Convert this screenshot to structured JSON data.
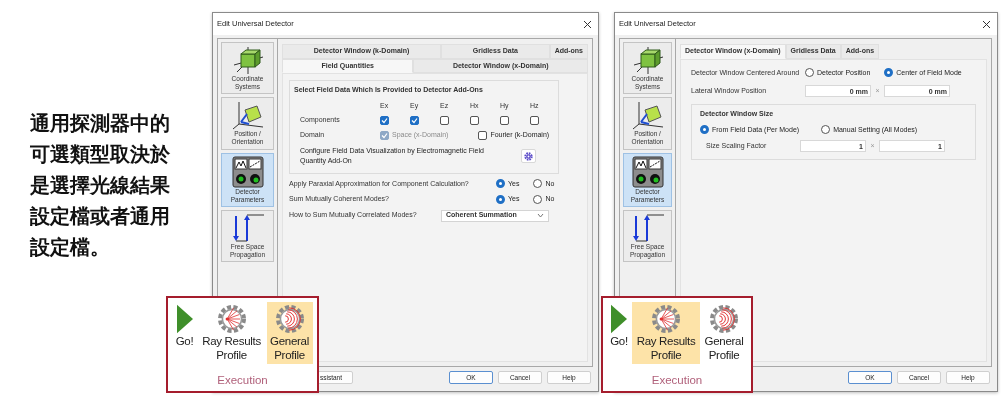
{
  "caption": "通用探測器中的可選類型取決於是選擇光線結果設定檔或者通用設定檔。",
  "dialogs": [
    {
      "title": "Edit Universal Detector",
      "sidebar": [
        {
          "label": "Coordinate Systems",
          "kind": "coords",
          "selected": false
        },
        {
          "label": "Position / Orientation",
          "kind": "position",
          "selected": false
        },
        {
          "label": "Detector Parameters",
          "kind": "detector",
          "selected": true
        },
        {
          "label": "Free Space Propagation",
          "kind": "propagation",
          "selected": false
        }
      ],
      "tab_rows": [
        [
          {
            "label": "Detector Window (k-Domain)",
            "selected": false
          },
          {
            "label": "Gridless Data",
            "selected": false
          },
          {
            "label": "Add-ons",
            "selected": false
          }
        ],
        [
          {
            "label": "Field Quantities",
            "selected": true
          },
          {
            "label": "Detector Window (x-Domain)",
            "selected": false
          }
        ]
      ],
      "rows": [
        {
          "kind": "group",
          "title": "Select Field Data Which Is Provided to Detector Add-Ons",
          "rows": [
            {
              "kind": "checkgrid",
              "label": "Components",
              "options": [
                {
                  "label": "Ex",
                  "checked": true
                },
                {
                  "label": "Ey",
                  "checked": true
                },
                {
                  "label": "Ez",
                  "checked": false
                },
                {
                  "label": "Hx",
                  "checked": false
                },
                {
                  "label": "Hy",
                  "checked": false
                },
                {
                  "label": "Hz",
                  "checked": false
                }
              ]
            },
            {
              "kind": "checks",
              "label": "Domain",
              "options": [
                {
                  "label": "Space (x-Domain)",
                  "checked": true,
                  "disabled": true
                },
                {
                  "label": "Fourier (k-Domain)",
                  "checked": false,
                  "disabled": false
                }
              ]
            },
            {
              "kind": "gear",
              "label": "Configure Field Data Visualization by Electromagnetic Field Quantity Add-On"
            }
          ]
        },
        {
          "kind": "radios",
          "label": "Apply Paraxial Approximation for Component Calculation?",
          "options": [
            {
              "label": "Yes",
              "selected": true
            },
            {
              "label": "No",
              "selected": false
            }
          ]
        },
        {
          "kind": "radios",
          "label": "Sum Mutually Coherent Modes?",
          "options": [
            {
              "label": "Yes",
              "selected": true
            },
            {
              "label": "No",
              "selected": false
            }
          ]
        },
        {
          "kind": "select",
          "label": "How to Sum Mutually Correlated Modes?",
          "value": "Coherent Summation"
        }
      ],
      "left_button": "ssistant",
      "buttons": [
        "OK",
        "Cancel",
        "Help"
      ],
      "ribbon": {
        "items": [
          {
            "label": "Go!",
            "kind": "go",
            "selected": false
          },
          {
            "label": "Ray Results Profile",
            "kind": "ray",
            "selected": false
          },
          {
            "label": "General Profile",
            "kind": "general",
            "selected": true
          }
        ],
        "group_label": "Execution"
      }
    },
    {
      "title": "Edit Universal Detector",
      "sidebar": [
        {
          "label": "Coordinate Systems",
          "kind": "coords",
          "selected": false
        },
        {
          "label": "Position / Orientation",
          "kind": "position",
          "selected": false
        },
        {
          "label": "Detector Parameters",
          "kind": "detector",
          "selected": true
        },
        {
          "label": "Free Space Propagation",
          "kind": "propagation",
          "selected": false
        }
      ],
      "tab_rows": [
        [
          {
            "label": "Detector Window (x-Domain)",
            "selected": true
          },
          {
            "label": "Gridless Data",
            "selected": false
          },
          {
            "label": "Add-ons",
            "selected": false
          }
        ]
      ],
      "rows": [
        {
          "kind": "radios",
          "label": "Detector Window Centered Around",
          "options": [
            {
              "label": "Detector Position",
              "selected": false
            },
            {
              "label": "Center of Field Mode",
              "selected": true
            }
          ]
        },
        {
          "kind": "pair",
          "label": "Lateral Window Position",
          "values": [
            "0 mm",
            "0 mm"
          ],
          "separator": "×"
        },
        {
          "kind": "group",
          "title": "Detector Window Size",
          "rows": [
            {
              "kind": "radios",
              "options": [
                {
                  "label": "From Field Data (Per Mode)",
                  "selected": true
                },
                {
                  "label": "Manual Setting (All Modes)",
                  "selected": false
                }
              ]
            },
            {
              "kind": "pair",
              "label": "Size Scaling Factor",
              "values": [
                "1",
                "1"
              ],
              "separator": "×"
            }
          ]
        }
      ],
      "buttons": [
        "OK",
        "Cancel",
        "Help"
      ],
      "ribbon": {
        "items": [
          {
            "label": "Go!",
            "kind": "go",
            "selected": false
          },
          {
            "label": "Ray Results Profile",
            "kind": "ray",
            "selected": true
          },
          {
            "label": "General Profile",
            "kind": "general",
            "selected": false
          }
        ],
        "group_label": "Execution"
      }
    }
  ]
}
